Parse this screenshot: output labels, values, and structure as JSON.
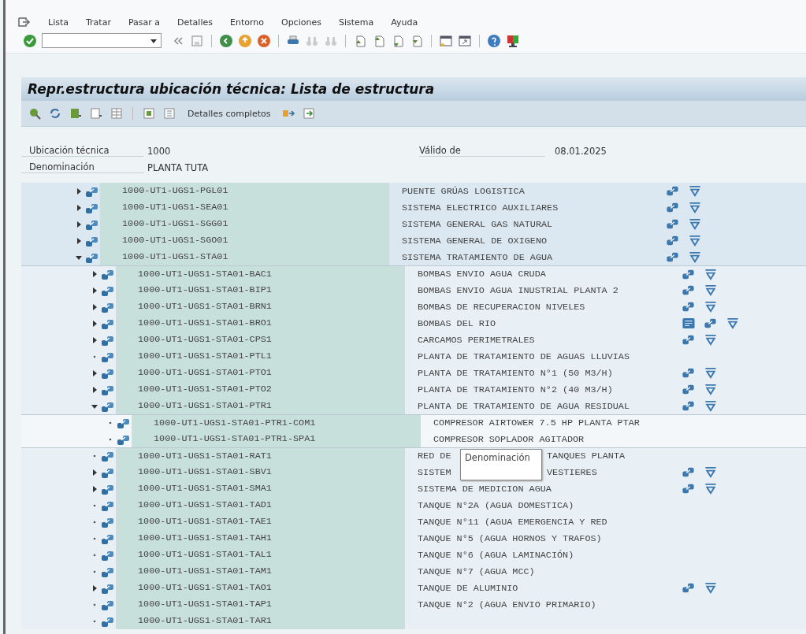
{
  "menu": [
    "Lista",
    "Tratar",
    "Pasar a",
    "Detalles",
    "Entorno",
    "Opciones",
    "Sistema",
    "Ayuda"
  ],
  "title": "Repr.estructura ubicación técnica: Lista de estructura",
  "app_toolbar": {
    "button_label": "Detalles completos"
  },
  "header": [
    {
      "label": "Ubicación técnica",
      "value": "1000",
      "label2": "Válido de",
      "value2": "08.01.2025"
    },
    {
      "label": "Denominación",
      "value": "PLANTA TUTA"
    }
  ],
  "tree": [
    {
      "id": "1000-UT1-UGS1-PGL01",
      "description": "PUENTE GRÚAS LOGISTICA",
      "kind": "branch",
      "expanded": false,
      "has_document": false,
      "has_structure": true,
      "has_filter": true
    },
    {
      "id": "1000-UT1-UGS1-SEA01",
      "description": "SISTEMA ELECTRICO AUXILIARES",
      "kind": "branch",
      "expanded": false,
      "has_document": false,
      "has_structure": true,
      "has_filter": true
    },
    {
      "id": "1000-UT1-UGS1-SGG01",
      "description": "SISTEMA GENERAL GAS NATURAL",
      "kind": "branch",
      "expanded": false,
      "has_document": false,
      "has_structure": true,
      "has_filter": true
    },
    {
      "id": "1000-UT1-UGS1-SGO01",
      "description": "SISTEMA GENERAL DE OXIGENO",
      "kind": "branch",
      "expanded": false,
      "has_document": false,
      "has_structure": true,
      "has_filter": true
    },
    {
      "id": "1000-UT1-UGS1-STA01",
      "description": "SISTEMA TRATAMIENTO DE AGUA",
      "kind": "branch",
      "expanded": true,
      "has_document": false,
      "has_structure": true,
      "has_filter": true,
      "children": [
        {
          "id": "1000-UT1-UGS1-STA01-BAC1",
          "description": "BOMBAS ENVIO AGUA CRUDA",
          "kind": "branch",
          "expanded": false,
          "has_document": false,
          "has_structure": true,
          "has_filter": true
        },
        {
          "id": "1000-UT1-UGS1-STA01-BIP1",
          "description": "BOMBAS ENVIO AGUA INUSTRIAL PLANTA 2",
          "kind": "branch",
          "expanded": false,
          "has_document": false,
          "has_structure": true,
          "has_filter": true
        },
        {
          "id": "1000-UT1-UGS1-STA01-BRN1",
          "description": "BOMBAS DE RECUPERACION NIVELES",
          "kind": "branch",
          "expanded": false,
          "has_document": false,
          "has_structure": true,
          "has_filter": true
        },
        {
          "id": "1000-UT1-UGS1-STA01-BRO1",
          "description": "BOMBAS DEL RIO",
          "kind": "branch",
          "expanded": false,
          "has_document": true,
          "has_structure": true,
          "has_filter": true
        },
        {
          "id": "1000-UT1-UGS1-STA01-CPS1",
          "description": "CARCAMOS PERIMETRALES",
          "kind": "branch",
          "expanded": false,
          "has_document": false,
          "has_structure": true,
          "has_filter": true
        },
        {
          "id": "1000-UT1-UGS1-STA01-PTL1",
          "description": "PLANTA DE TRATAMIENTO DE AGUAS LLUVIAS",
          "kind": "leaf",
          "has_document": false,
          "has_structure": false,
          "has_filter": false
        },
        {
          "id": "1000-UT1-UGS1-STA01-PTO1",
          "description": "PLANTA DE TRATAMIENTO N°1 (50 M3/H)",
          "kind": "branch",
          "expanded": false,
          "has_document": false,
          "has_structure": true,
          "has_filter": true
        },
        {
          "id": "1000-UT1-UGS1-STA01-PTO2",
          "description": "PLANTA DE TRATAMIENTO N°2 (40 M3/H)",
          "kind": "branch",
          "expanded": false,
          "has_document": false,
          "has_structure": true,
          "has_filter": true
        },
        {
          "id": "1000-UT1-UGS1-STA01-PTR1",
          "description": "PLANTA DE TRATAMIENTO DE AGUA RESIDUAL",
          "kind": "branch",
          "expanded": true,
          "has_document": false,
          "has_structure": true,
          "has_filter": true,
          "children": [
            {
              "id": "1000-UT1-UGS1-STA01-PTR1-COM1",
              "description": "COMPRESOR AIRTOWER 7.5 HP PLANTA PTAR",
              "kind": "leaf",
              "has_document": false,
              "has_structure": false,
              "has_filter": false
            },
            {
              "id": "1000-UT1-UGS1-STA01-PTR1-SPA1",
              "description": "COMPRESOR SOPLADOR AGITADOR",
              "kind": "leaf",
              "has_document": false,
              "has_structure": false,
              "has_filter": false
            }
          ]
        },
        {
          "id": "1000-UT1-UGS1-STA01-RAT1",
          "description": "RED DE",
          "description_tail": "TANQUES PLANTA",
          "kind": "leaf",
          "has_document": false,
          "has_structure": false,
          "has_filter": false
        },
        {
          "id": "1000-UT1-UGS1-STA01-SBV1",
          "description": "SISTEM",
          "description_tail": "VESTIERES",
          "kind": "branch",
          "expanded": false,
          "has_document": false,
          "has_structure": true,
          "has_filter": true
        },
        {
          "id": "1000-UT1-UGS1-STA01-SMA1",
          "description": "SISTEMA DE MEDICION AGUA",
          "kind": "branch",
          "expanded": false,
          "has_document": false,
          "has_structure": true,
          "has_filter": true
        },
        {
          "id": "1000-UT1-UGS1-STA01-TAD1",
          "description": "TANQUE N°2A (AGUA DOMESTICA)",
          "kind": "leaf",
          "has_document": false,
          "has_structure": false,
          "has_filter": false
        },
        {
          "id": "1000-UT1-UGS1-STA01-TAE1",
          "description": "TANQUE N°11 (AGUA EMERGENCIA Y RED",
          "kind": "leaf",
          "has_document": false,
          "has_structure": false,
          "has_filter": false
        },
        {
          "id": "1000-UT1-UGS1-STA01-TAH1",
          "description": "TANQUE N°5 (AGUA HORNOS Y TRAFOS)",
          "kind": "leaf",
          "has_document": false,
          "has_structure": false,
          "has_filter": false
        },
        {
          "id": "1000-UT1-UGS1-STA01-TAL1",
          "description": "TANQUE N°6 (AGUA LAMINACIÓN)",
          "kind": "leaf",
          "has_document": false,
          "has_structure": false,
          "has_filter": false
        },
        {
          "id": "1000-UT1-UGS1-STA01-TAM1",
          "description": "TANQUE N°7 (AGUA MCC)",
          "kind": "leaf",
          "has_document": false,
          "has_structure": false,
          "has_filter": false
        },
        {
          "id": "1000-UT1-UGS1-STA01-TAO1",
          "description": "TANQUE DE ALUMINIO",
          "kind": "branch",
          "expanded": false,
          "has_document": false,
          "has_structure": true,
          "has_filter": true
        },
        {
          "id": "1000-UT1-UGS1-STA01-TAP1",
          "description": "TANQUE N°2 (AGUA ENVIO PRIMARIO)",
          "kind": "leaf",
          "has_document": false,
          "has_structure": false,
          "has_filter": false
        },
        {
          "id": "1000-UT1-UGS1-STA01-TAR1",
          "kind": "leaf",
          "has_document": false,
          "has_structure": false,
          "has_filter": false
        }
      ]
    }
  ],
  "tooltip": {
    "text": "Denominación"
  }
}
